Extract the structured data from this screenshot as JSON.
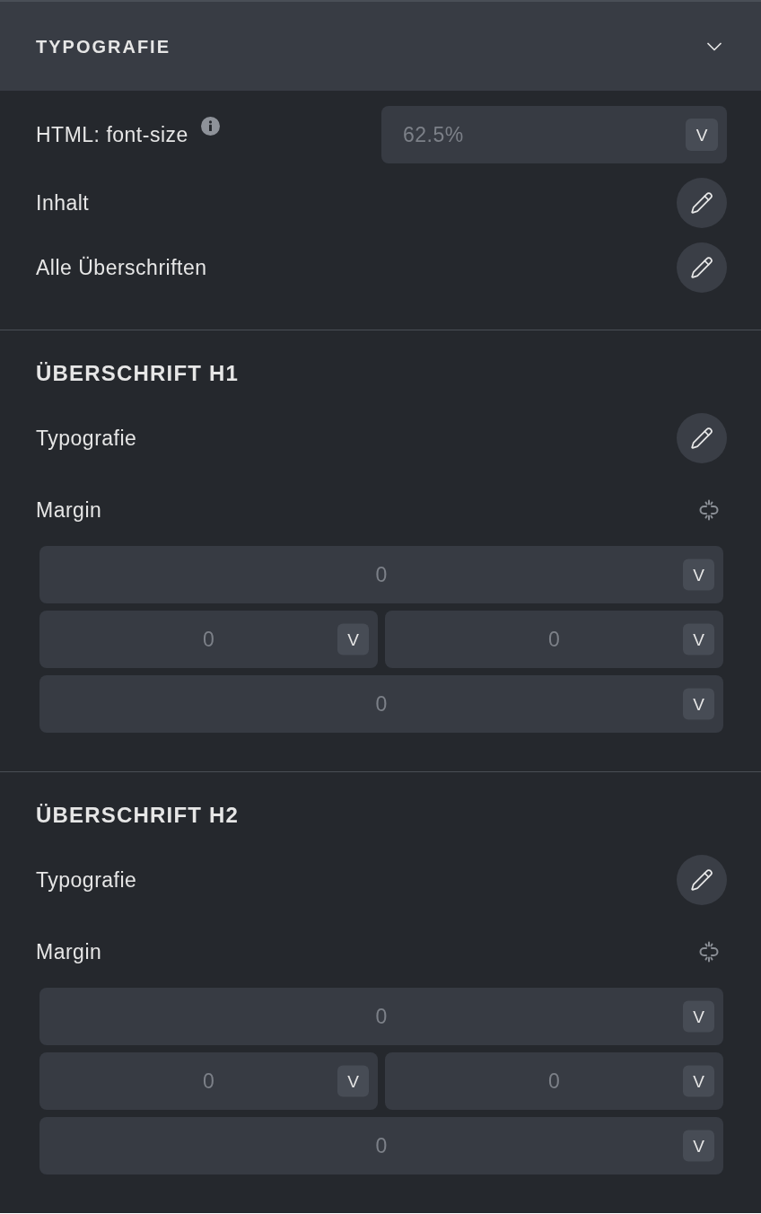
{
  "panel": {
    "title": "TYPOGRAFIE",
    "expanded": true
  },
  "settings": [
    {
      "kind": "select",
      "label": "HTML: font-size",
      "info": true,
      "placeholder": "62.5%",
      "unit": "V"
    },
    {
      "kind": "edit",
      "label": "Inhalt"
    },
    {
      "kind": "edit",
      "label": "Alle Überschriften"
    }
  ],
  "sections": [
    {
      "heading": "ÜBERSCHRIFT H1",
      "rows": [
        {
          "kind": "edit",
          "label": "Typografie"
        }
      ],
      "margin": {
        "label": "Margin",
        "linked": false,
        "fields": [
          {
            "kind": "wide",
            "placeholder": "0",
            "unit": "V"
          },
          {
            "kind": "half",
            "placeholder": "0",
            "unit": "V"
          },
          {
            "kind": "half",
            "placeholder": "0",
            "unit": "V"
          },
          {
            "kind": "wide",
            "placeholder": "0",
            "unit": "V"
          }
        ]
      }
    },
    {
      "heading": "ÜBERSCHRIFT H2",
      "rows": [
        {
          "kind": "edit",
          "label": "Typografie"
        }
      ],
      "margin": {
        "label": "Margin",
        "linked": false,
        "fields": [
          {
            "kind": "wide",
            "placeholder": "0",
            "unit": "V"
          },
          {
            "kind": "half",
            "placeholder": "0",
            "unit": "V"
          },
          {
            "kind": "half",
            "placeholder": "0",
            "unit": "V"
          },
          {
            "kind": "wide",
            "placeholder": "0",
            "unit": "V"
          }
        ]
      }
    }
  ]
}
